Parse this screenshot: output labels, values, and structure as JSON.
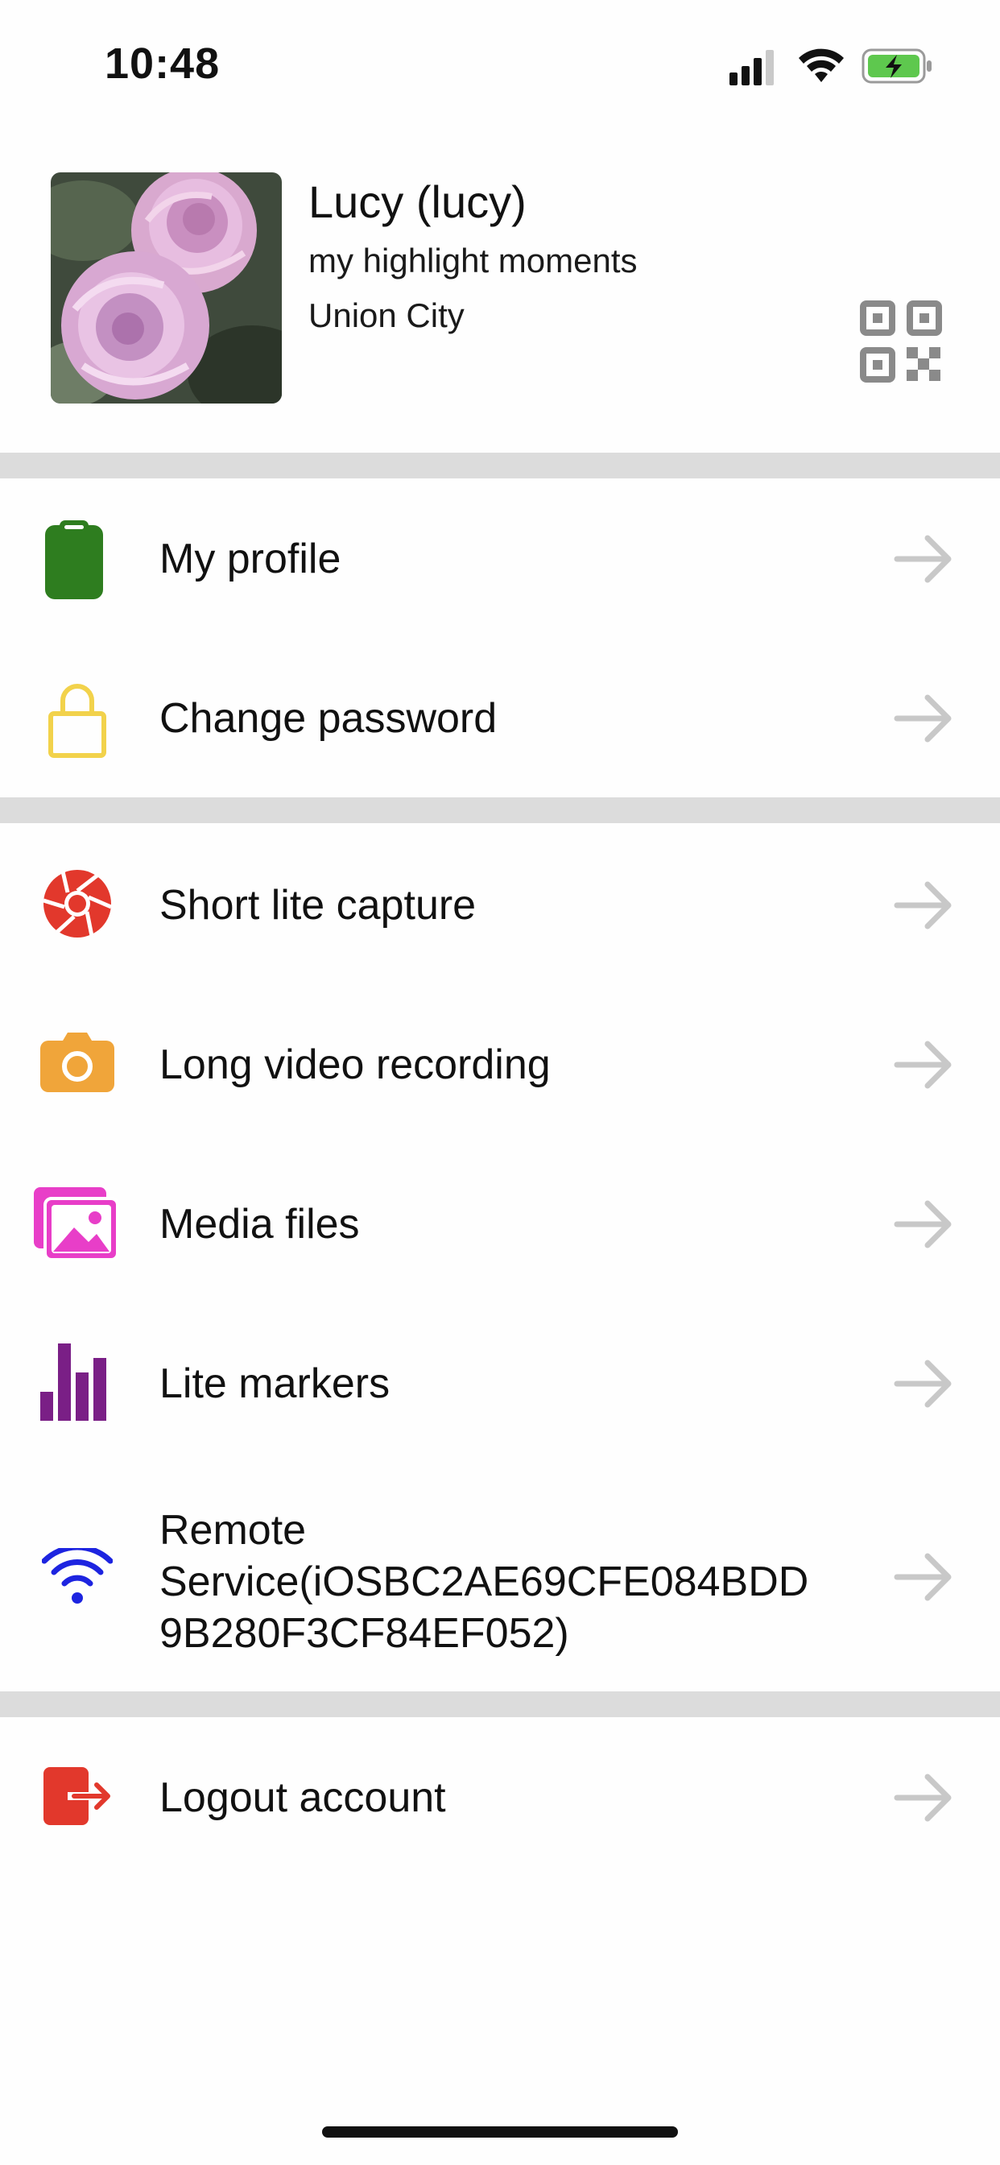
{
  "status_bar": {
    "time": "10:48"
  },
  "profile": {
    "name": "Lucy (lucy)",
    "motto": "my highlight moments",
    "city": "Union City"
  },
  "menu": {
    "my_profile": {
      "label": "My profile",
      "icon": "clipboard-icon",
      "color": "#2e7d1f"
    },
    "change_password": {
      "label": "Change password",
      "icon": "lock-icon",
      "color": "#f2d24b"
    },
    "short_lite_capture": {
      "label": "Short lite capture",
      "icon": "aperture-icon",
      "color": "#e2382c"
    },
    "long_video_recording": {
      "label": "Long video recording",
      "icon": "camera-icon",
      "color": "#f0a53a"
    },
    "media_files": {
      "label": "Media files",
      "icon": "gallery-icon",
      "color": "#e83ec8"
    },
    "lite_markers": {
      "label": "Lite markers",
      "icon": "bar-chart-icon",
      "color": "#7a1f86"
    },
    "remote_service": {
      "line1": "Remote",
      "line2": "Service(iOSBC2AE69CFE084BDD",
      "line3": "9B280F3CF84EF052)",
      "icon": "wifi-icon",
      "color": "#1d24e0"
    },
    "logout": {
      "label": "Logout account",
      "icon": "logout-icon",
      "color": "#e2382c"
    }
  },
  "colors": {
    "divider": "#dcdcdc",
    "arrow": "#c8c8c8"
  }
}
